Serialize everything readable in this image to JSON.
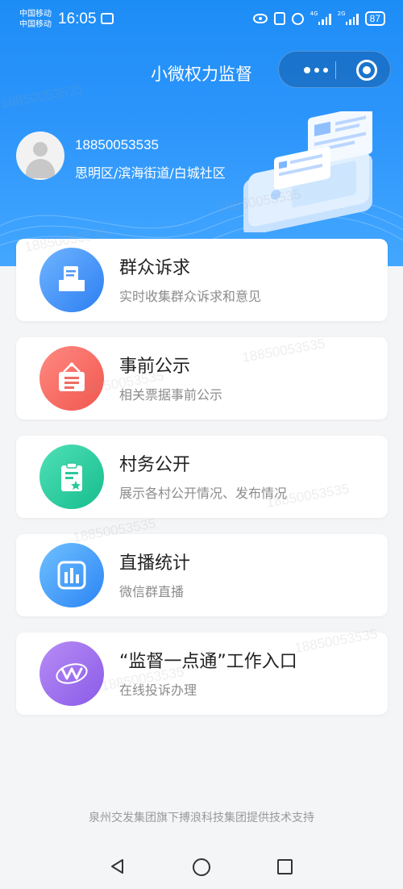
{
  "status_bar": {
    "carrier_1": "中国移动",
    "carrier_2": "中国移动",
    "time": "16:05",
    "network_1": "4G",
    "network_2": "2G",
    "battery": "87"
  },
  "header": {
    "title": "小微权力监督"
  },
  "user": {
    "phone": "18850053535",
    "address": "思明区/滨海街道/白城社区"
  },
  "menu": [
    {
      "title": "群众诉求",
      "subtitle": "实时收集群众诉求和意见",
      "icon": "inbox-document-icon",
      "color_from": "#6fb4ff",
      "color_to": "#2d7ff2"
    },
    {
      "title": "事前公示",
      "subtitle": "相关票据事前公示",
      "icon": "notice-board-icon",
      "color_from": "#ff8a82",
      "color_to": "#f0564e"
    },
    {
      "title": "村务公开",
      "subtitle": "展示各村公开情况、发布情况",
      "icon": "clipboard-star-icon",
      "color_from": "#4fe0b6",
      "color_to": "#16bd8e"
    },
    {
      "title": "直播统计",
      "subtitle": "微信群直播",
      "icon": "bar-chart-icon",
      "color_from": "#6fc0ff",
      "color_to": "#2b85f4"
    },
    {
      "title": "“监督一点通”工作入口",
      "subtitle": "在线投诉办理",
      "icon": "brand-logo-icon",
      "color_from": "#b78cf5",
      "color_to": "#8a5be8"
    }
  ],
  "footer": {
    "text": "泉州交发集团旗下搏浪科技集团提供技术支持"
  },
  "watermark": "18850053535"
}
